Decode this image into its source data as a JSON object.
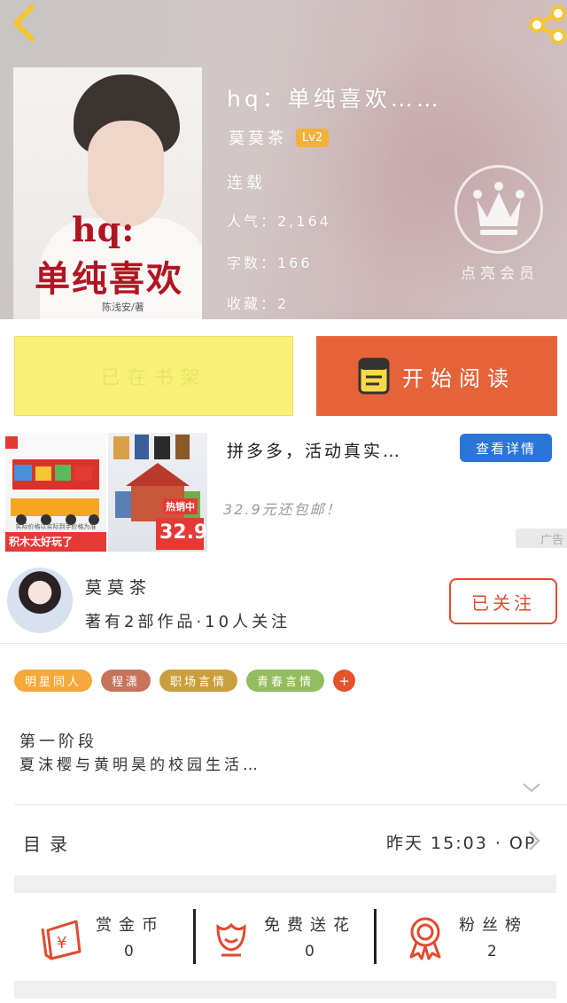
{
  "header": {
    "book_title": "hq：单纯喜欢……",
    "author": "莫莫茶",
    "level": "Lv2",
    "status": "连载",
    "popularity": "人气：2,164",
    "word_count": "字数：166",
    "collections": "收藏：2",
    "crown_label": "点亮会员"
  },
  "cover": {
    "title_line1": "hq:",
    "title_line2": "单纯喜欢",
    "author": "陈浅安/著"
  },
  "actions": {
    "shelf_label": "已在书架",
    "read_label": "开始阅读"
  },
  "ad": {
    "title": "拼多多，活动真实…",
    "button": "查看详情",
    "subtitle": "32.9元还包邮！",
    "tag": "广告",
    "img1_banner": "积木太好玩了",
    "img1_caption": "实际价格以实际到手价格为准",
    "img2_badge": "热销中",
    "img2_price": "32.9"
  },
  "author_section": {
    "name": "莫莫茶",
    "meta": "著有2部作品·10人关注",
    "follow_label": "已关注"
  },
  "tags": [
    {
      "label": "明星同人",
      "color": "#f5a93b"
    },
    {
      "label": "程潇",
      "color": "#c7735b"
    },
    {
      "label": "职场言情",
      "color": "#c9a03c"
    },
    {
      "label": "青春言情",
      "color": "#93bd5e"
    }
  ],
  "tag_more": "+",
  "description": {
    "line1": "第一阶段",
    "line2": "夏沫樱与黄明昊的校园生活…"
  },
  "catalog": {
    "label": "目录",
    "updated": "昨天 15:03 · OP"
  },
  "bottom_stats": [
    {
      "label": "赏金币",
      "value": "0"
    },
    {
      "label": "免费送花",
      "value": "0"
    },
    {
      "label": "粉丝榜",
      "value": "2"
    }
  ],
  "colors": {
    "accent": "#e6633a",
    "shelf_yellow": "#f9f178",
    "icon_red": "#e24a2e",
    "ad_blue": "#2b74d8"
  }
}
